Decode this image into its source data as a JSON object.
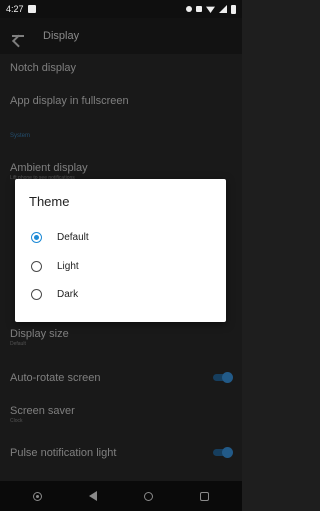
{
  "status_bar": {
    "time": "4:27"
  },
  "app_bar": {
    "title": "Display"
  },
  "settings": {
    "notch": {
      "title": "Notch display"
    },
    "fullscreen": {
      "title": "App display in fullscreen"
    },
    "section_system": "System",
    "ambient": {
      "title": "Ambient display",
      "subtitle": "Lift phone to see notifications"
    },
    "display_size": {
      "title": "Display size",
      "subtitle": "Default"
    },
    "auto_rotate": {
      "title": "Auto-rotate screen",
      "enabled": true
    },
    "screen_saver": {
      "title": "Screen saver",
      "subtitle": "Clock"
    },
    "pulse": {
      "title": "Pulse notification light",
      "enabled": true
    }
  },
  "dialog": {
    "title": "Theme",
    "options": [
      {
        "label": "Default",
        "selected": true
      },
      {
        "label": "Light",
        "selected": false
      },
      {
        "label": "Dark",
        "selected": false
      }
    ]
  },
  "icons": {
    "back": "arrow-back-icon",
    "radio_selected": "radio-on-icon",
    "radio_unselected": "radio-off-icon"
  },
  "colors": {
    "accent": "#1d8ad6",
    "background": "#1f1f1f",
    "dialog": "#ffffff"
  }
}
